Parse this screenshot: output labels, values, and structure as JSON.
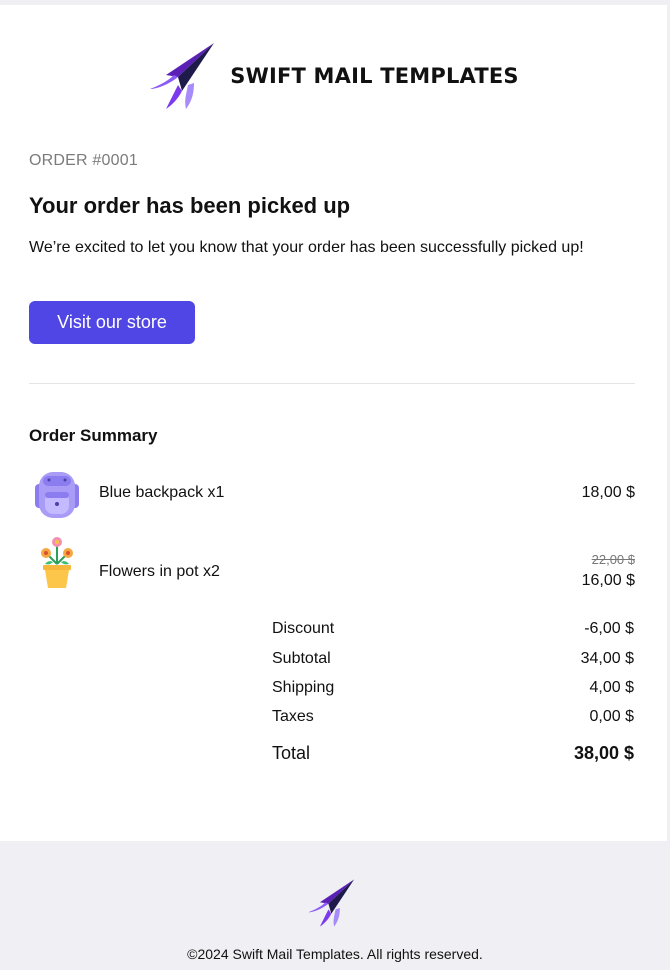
{
  "header": {
    "brand": "SWIFT MAIL TEMPLATES"
  },
  "order": {
    "number": "ORDER #0001",
    "headline": "Your order has been picked up",
    "intro": "We’re excited to let you know that your order has been successfully picked up!",
    "cta_label": "Visit our store"
  },
  "summary": {
    "title": "Order Summary",
    "items": [
      {
        "name": "Blue backpack x1",
        "price": "18,00 $",
        "icon": "backpack-icon"
      },
      {
        "name": "Flowers in pot x2",
        "old_price": "22,00 $",
        "price": "16,00 $",
        "icon": "flower-pot-icon"
      }
    ],
    "totals": [
      {
        "label": "Discount",
        "value": "-6,00 $"
      },
      {
        "label": "Subtotal",
        "value": "34,00 $"
      },
      {
        "label": "Shipping",
        "value": "4,00 $"
      },
      {
        "label": "Taxes",
        "value": "0,00 $"
      }
    ],
    "total": {
      "label": "Total",
      "value": "38,00 $"
    }
  },
  "footer": {
    "copyright": "©2024 Swift Mail Templates. All rights reserved."
  },
  "colors": {
    "accent": "#4f46e5",
    "logo_purple": "#7c3aed",
    "logo_dark": "#1e1b4b",
    "background": "#f0f0f4"
  }
}
